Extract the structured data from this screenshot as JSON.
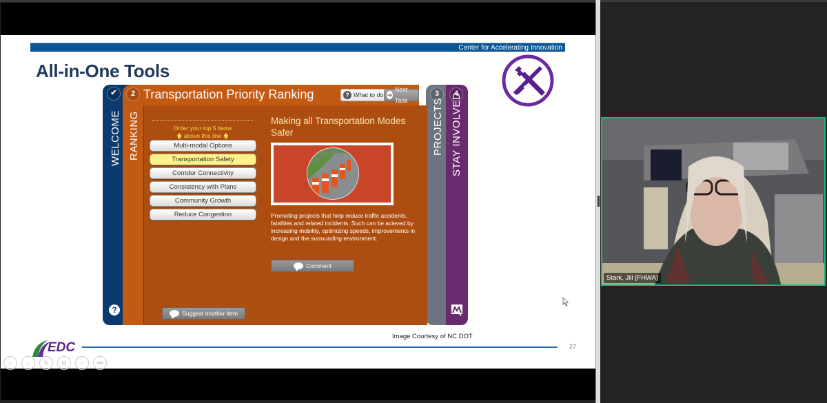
{
  "slide": {
    "header_text": "Center for Accelerating Innovation",
    "title": "All-in-One Tools",
    "courtesy": "Image Courtesy of NC DOT",
    "page_number": "27",
    "logo_text": "EDC",
    "icon": "tools-wrench-screwdriver-icon"
  },
  "app": {
    "tabs": [
      {
        "number": "✔",
        "label": "WELCOME"
      },
      {
        "number": "2",
        "label": "RANKING"
      },
      {
        "number": "3",
        "label": "PROJECTS"
      },
      {
        "number": "4",
        "label": "STAY INVOLVED"
      }
    ],
    "title": "Transportation Priority Ranking",
    "what_to_do_label": "What to do",
    "next_task_label": "Next Task",
    "order_line1": "Order your top 5 items",
    "order_line2": "above this line",
    "ranking_items": [
      "Multi-modal Options",
      "Transportation Safety",
      "Corridor Connectivity",
      "Consistency with Plans",
      "Community Growth",
      "Reduce Congestion"
    ],
    "selected_item_index": 1,
    "detail_title": "Making all Transportation Modes Safer",
    "detail_description": "Promoting projects that help reduce traffic accidents, fatalities and related incidents. Such can be acieved by increasing mobility, optimizing speeds, improvements in design and the surrounding environment.",
    "comment_label": "Comment",
    "suggest_label": "Suggest another item",
    "help_glyph": "?"
  },
  "controls": [
    "‹",
    "›",
    "✎",
    "⧉",
    "⌕",
    "•••"
  ],
  "video": {
    "participant_name": "Stark, Jill (FHWA)"
  },
  "colors": {
    "welcome_tab": "#0a3a6e",
    "ranking_tab": "#c25a14",
    "projects_tab": "#6d7480",
    "stay_tab": "#6a2a6e",
    "header_bar": "#0a5596",
    "active_speaker_border": "#1fb37a"
  }
}
